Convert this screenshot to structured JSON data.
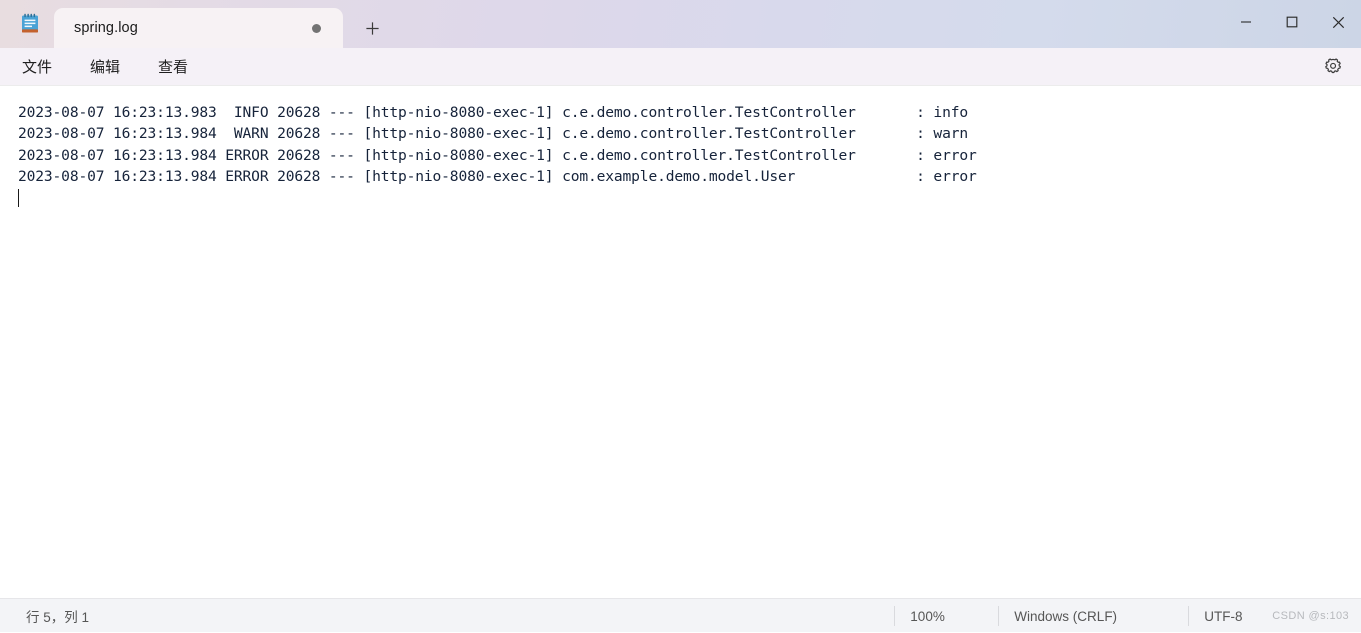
{
  "titlebar": {
    "app_icon": "notepad-icon",
    "tabs": [
      {
        "label": "spring.log",
        "modified_dot": "●",
        "active": true
      }
    ],
    "new_tab_label": "+",
    "window_controls": {
      "minimize": "—",
      "maximize": "□",
      "close": "✕"
    }
  },
  "menubar": {
    "items": [
      {
        "label": "文件"
      },
      {
        "label": "编辑"
      },
      {
        "label": "查看"
      }
    ],
    "settings_icon": "gear-icon"
  },
  "editor": {
    "lines": [
      "2023-08-07 16:23:13.983  INFO 20628 --- [http-nio-8080-exec-1] c.e.demo.controller.TestController       : info",
      "2023-08-07 16:23:13.984  WARN 20628 --- [http-nio-8080-exec-1] c.e.demo.controller.TestController       : warn",
      "2023-08-07 16:23:13.984 ERROR 20628 --- [http-nio-8080-exec-1] c.e.demo.controller.TestController       : error",
      "2023-08-07 16:23:13.984 ERROR 20628 --- [http-nio-8080-exec-1] com.example.demo.model.User              : error"
    ],
    "caret_line": 5,
    "text_color": "#16233a",
    "background": "#ffffff"
  },
  "statusbar": {
    "position": "行 5，列 1",
    "zoom": "100%",
    "line_ending": "Windows (CRLF)",
    "encoding": "UTF-8",
    "watermark": "CSDN @s:103"
  }
}
